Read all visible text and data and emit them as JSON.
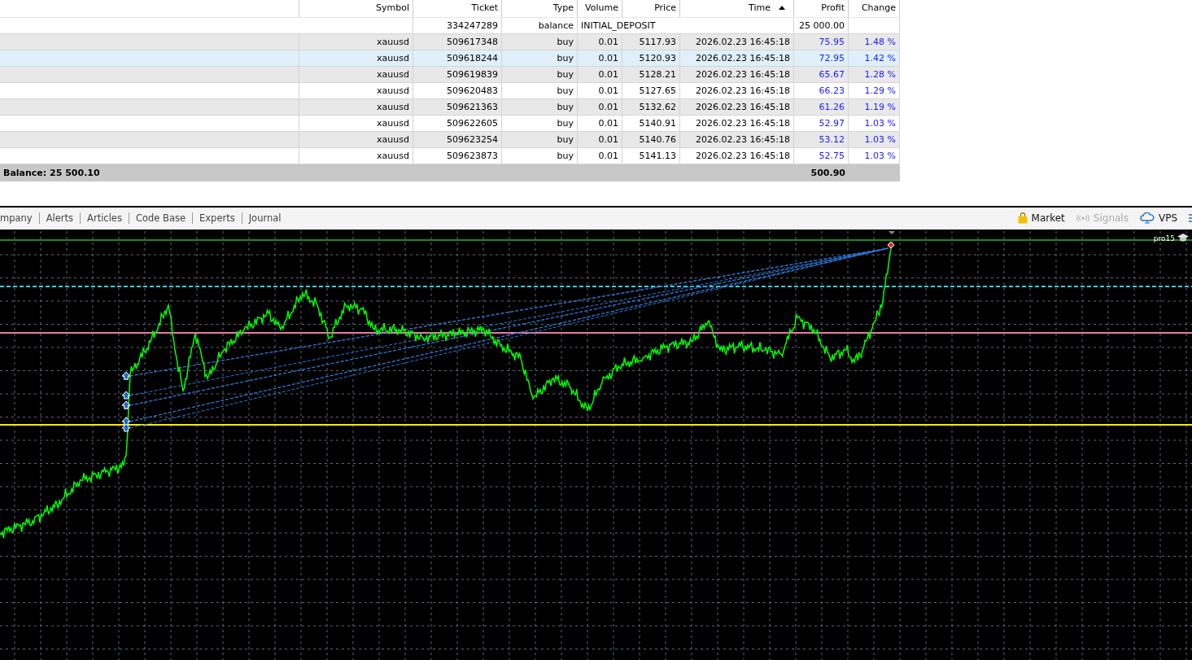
{
  "table": {
    "columns": [
      {
        "sorted": false
      },
      {
        "label": "Symbol",
        "sorted": false
      },
      {
        "label": "Ticket",
        "sorted": false
      },
      {
        "label": "Type",
        "sorted": false
      },
      {
        "label": "Volume",
        "sorted": false
      },
      {
        "label": "Price",
        "sorted": false
      },
      {
        "label": "Time",
        "sorted": true
      },
      {
        "label": "Profit",
        "sorted": false
      },
      {
        "label": "Change",
        "sorted": false
      }
    ],
    "deposit": {
      "ticket": "334247289",
      "type": "balance",
      "comment": "INITIAL_DEPOSIT",
      "profit": "25 000.00"
    },
    "rows": [
      {
        "symbol": "xauusd",
        "ticket": "509617348",
        "type": "buy",
        "volume": "0.01",
        "price": "5117.93",
        "time": "2026.02.23 16:45:18",
        "profit": "75.95",
        "change": "1.48 %",
        "selected": false
      },
      {
        "symbol": "xauusd",
        "ticket": "509618244",
        "type": "buy",
        "volume": "0.01",
        "price": "5120.93",
        "time": "2026.02.23 16:45:18",
        "profit": "72.95",
        "change": "1.42 %",
        "selected": true
      },
      {
        "symbol": "xauusd",
        "ticket": "509619839",
        "type": "buy",
        "volume": "0.01",
        "price": "5128.21",
        "time": "2026.02.23 16:45:18",
        "profit": "65.67",
        "change": "1.28 %",
        "selected": false
      },
      {
        "symbol": "xauusd",
        "ticket": "509620483",
        "type": "buy",
        "volume": "0.01",
        "price": "5127.65",
        "time": "2026.02.23 16:45:18",
        "profit": "66.23",
        "change": "1.29 %",
        "selected": false
      },
      {
        "symbol": "xauusd",
        "ticket": "509621363",
        "type": "buy",
        "volume": "0.01",
        "price": "5132.62",
        "time": "2026.02.23 16:45:18",
        "profit": "61.26",
        "change": "1.19 %",
        "selected": false
      },
      {
        "symbol": "xauusd",
        "ticket": "509622605",
        "type": "buy",
        "volume": "0.01",
        "price": "5140.91",
        "time": "2026.02.23 16:45:18",
        "profit": "52.97",
        "change": "1.03 %",
        "selected": false
      },
      {
        "symbol": "xauusd",
        "ticket": "509623254",
        "type": "buy",
        "volume": "0.01",
        "price": "5140.76",
        "time": "2026.02.23 16:45:18",
        "profit": "53.12",
        "change": "1.03 %",
        "selected": false
      },
      {
        "symbol": "xauusd",
        "ticket": "509623873",
        "type": "buy",
        "volume": "0.01",
        "price": "5141.13",
        "time": "2026.02.23 16:45:18",
        "profit": "52.75",
        "change": "1.03 %",
        "selected": false
      }
    ],
    "summary": {
      "balance": "Balance: 25 500.10",
      "profit": "500.90"
    }
  },
  "toolbox_tabs": [
    {
      "label": "mpany"
    },
    {
      "label": "Alerts"
    },
    {
      "label": "Articles"
    },
    {
      "label": "Code Base"
    },
    {
      "label": "Experts"
    },
    {
      "label": "Journal"
    }
  ],
  "toolbar_links": [
    {
      "kind": "market",
      "label": "Market",
      "disabled": false
    },
    {
      "kind": "signals",
      "label": "Signals",
      "disabled": true
    },
    {
      "kind": "vps",
      "label": "VPS",
      "disabled": false
    }
  ],
  "chart": {
    "account_label": "pro15"
  }
}
